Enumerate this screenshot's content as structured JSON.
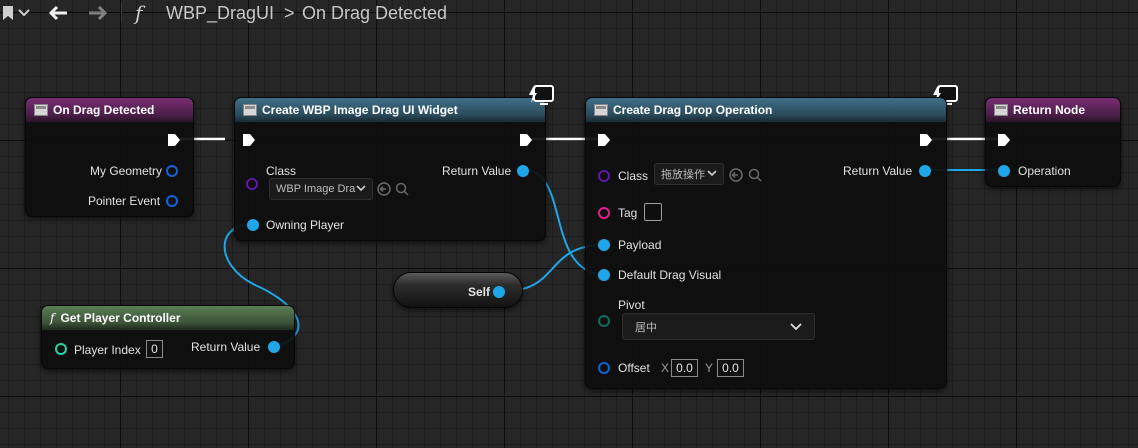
{
  "breadcrumb": {
    "graph_name": "WBP_DragUI",
    "separator": ">",
    "function_name": "On Drag Detected"
  },
  "nodes": {
    "on_drag_detected": {
      "title": "On Drag Detected",
      "pins": {
        "my_geometry": "My Geometry",
        "pointer_event": "Pointer Event"
      }
    },
    "create_widget": {
      "title": "Create WBP Image Drag UI Widget",
      "pins": {
        "class": "Class",
        "class_value": "WBP Image Dra",
        "owning_player": "Owning Player",
        "return_value": "Return Value"
      }
    },
    "get_player_controller": {
      "title": "Get Player Controller",
      "pins": {
        "player_index": "Player Index",
        "player_index_value": "0",
        "return_value": "Return Value"
      }
    },
    "self": {
      "label": "Self"
    },
    "create_drag_drop": {
      "title": "Create Drag Drop Operation",
      "pins": {
        "class": "Class",
        "class_value": "拖放操作",
        "tag": "Tag",
        "payload": "Payload",
        "default_drag_visual": "Default Drag Visual",
        "pivot": "Pivot",
        "pivot_value": "居中",
        "offset": "Offset",
        "offset_x_label": "X",
        "offset_x": "0.0",
        "offset_y_label": "Y",
        "offset_y": "0.0",
        "return_value": "Return Value"
      }
    },
    "return_node": {
      "title": "Return Node",
      "pins": {
        "operation": "Operation"
      }
    }
  },
  "colors": {
    "object_pin": "#1ea6e8",
    "class_pin": "#5a1aa8",
    "tag_pin": "#e61e8c",
    "enum_pin": "#0c6c5c",
    "struct_pin": "#1063d6",
    "int_pin": "#22d6a4",
    "exec_wire": "#ffffff"
  },
  "icons": [
    "bookmark-icon",
    "chevron-down-icon",
    "back-arrow-icon",
    "forward-arrow-icon",
    "function-icon",
    "latent-monitor-icon",
    "search-icon",
    "browse-icon"
  ]
}
